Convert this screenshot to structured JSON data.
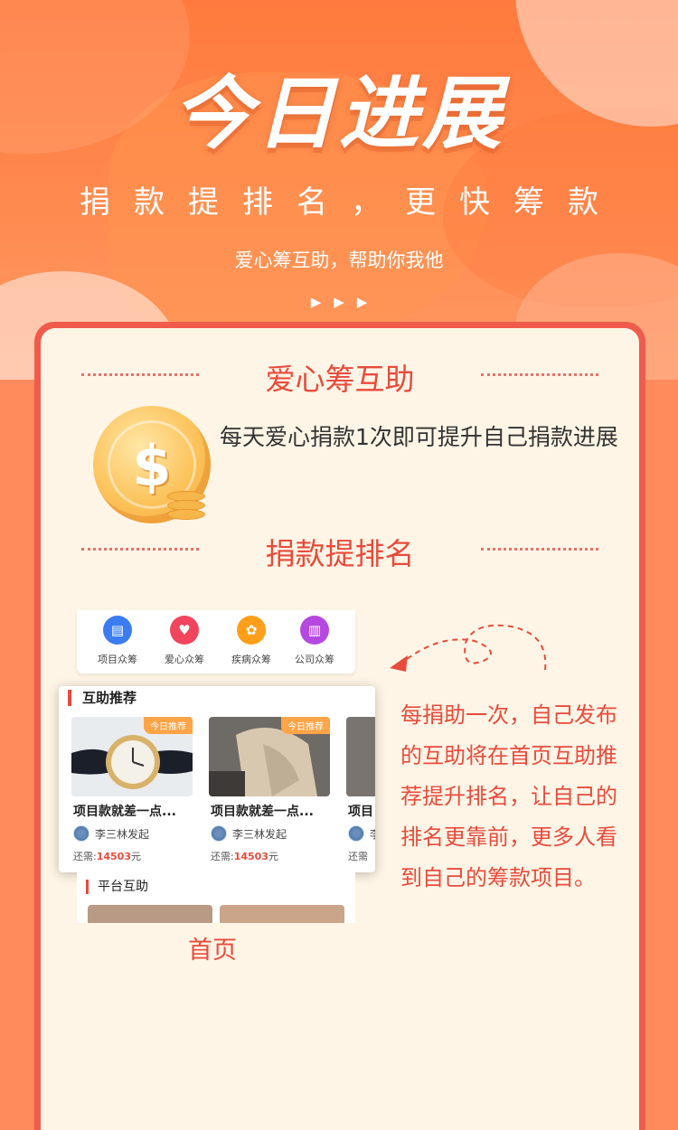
{
  "hero": {
    "title": "今日进展",
    "subtitle": "捐款提排名，更快筹款",
    "tagline": "爱心筹互助，帮助你我他",
    "arrows": "▶▶▶"
  },
  "section1": {
    "title": "爱心筹互助",
    "description": "每天爱心捐款1次即可提升自己捐款进展",
    "coin_symbol": "$"
  },
  "section2": {
    "title": "捐款提排名",
    "description": "每捐助一次，自己发布的互助将在首页互助推荐提升排名，让自己的排名更靠前，更多人看到自己的筹款项目。",
    "caption": "首页"
  },
  "screenshot": {
    "categories": [
      {
        "label": "项目众筹",
        "icon": "clipboard-icon",
        "color": "#3b7cf0"
      },
      {
        "label": "爱心众筹",
        "icon": "heart-icon",
        "color": "#f0455c"
      },
      {
        "label": "疾病众筹",
        "icon": "gear-icon",
        "color": "#ff9e1b"
      },
      {
        "label": "公司众筹",
        "icon": "building-icon",
        "color": "#b548e0"
      }
    ],
    "recommend_title": "互助推荐",
    "items": [
      {
        "tag": "今日推荐",
        "name": "项目款就差一点...",
        "initiator": "李三林发起",
        "need_label": "还需:",
        "amount": "14503",
        "unit": "元"
      },
      {
        "tag": "今日推荐",
        "name": "项目款就差一点...",
        "initiator": "李三林发起",
        "need_label": "还需:",
        "amount": "14503",
        "unit": "元"
      },
      {
        "tag": "",
        "name": "项目",
        "initiator": "李",
        "need_label": "还需",
        "amount": "",
        "unit": ""
      }
    ],
    "platform_title": "平台互助"
  }
}
